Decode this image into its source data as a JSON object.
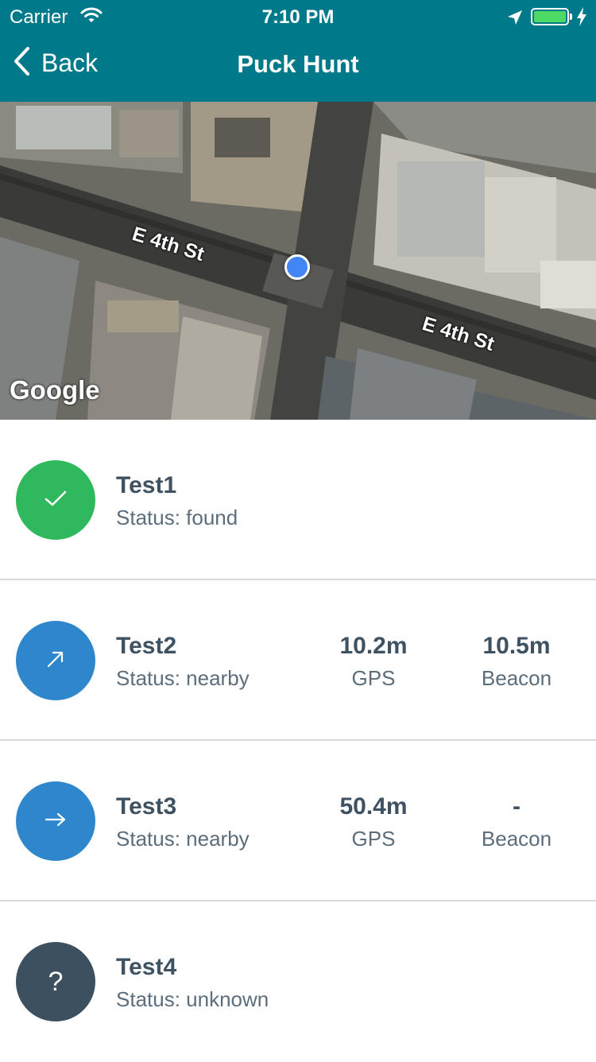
{
  "status_bar": {
    "carrier": "Carrier",
    "time": "7:10 PM"
  },
  "nav": {
    "back_label": "Back",
    "title": "Puck Hunt"
  },
  "map": {
    "street_labels": [
      "E 4th St",
      "E 4th St"
    ],
    "attribution": "Google"
  },
  "items": [
    {
      "name": "Test1",
      "status": "Status: found",
      "icon": "check-icon",
      "color": "#2fb85c"
    },
    {
      "name": "Test2",
      "status": "Status: nearby",
      "icon": "arrow-up-right-icon",
      "color": "#2e87cc",
      "gps_value": "10.2m",
      "gps_label": "GPS",
      "beacon_value": "10.5m",
      "beacon_label": "Beacon"
    },
    {
      "name": "Test3",
      "status": "Status: nearby",
      "icon": "arrow-right-icon",
      "color": "#2e87cc",
      "gps_value": "50.4m",
      "gps_label": "GPS",
      "beacon_value": "-",
      "beacon_label": "Beacon"
    },
    {
      "name": "Test4",
      "status": "Status: unknown",
      "icon": "question-icon",
      "color": "#3c5060",
      "glyph": "?"
    }
  ]
}
